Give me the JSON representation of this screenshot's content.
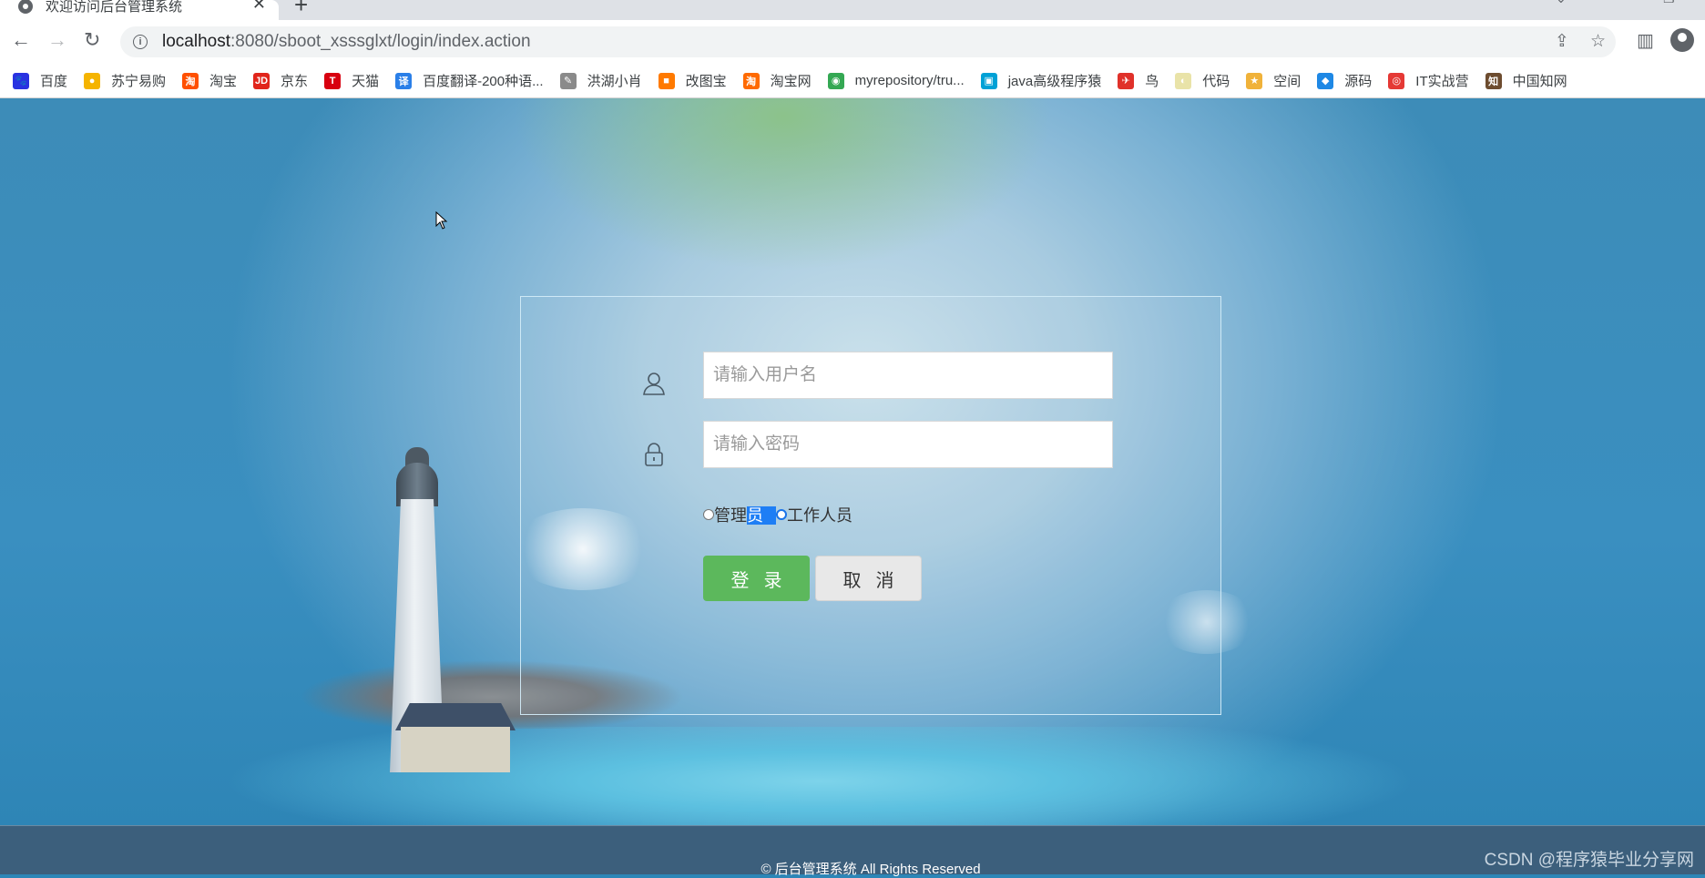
{
  "browser": {
    "tab_title": "欢迎访问后台管理系统",
    "url_host": "localhost",
    "url_rest": ":8080/sboot_xsssglxt/login/index.action",
    "bookmarks": [
      {
        "label": "百度",
        "icon": "baidu-paw-icon",
        "color": "#2932e1",
        "glyph": "🐾"
      },
      {
        "label": "苏宁易购",
        "icon": "suning-icon",
        "color": "#f5b400",
        "glyph": "●"
      },
      {
        "label": "淘宝",
        "icon": "taobao-icon",
        "color": "#ff5000",
        "glyph": "淘"
      },
      {
        "label": "京东",
        "icon": "jd-icon",
        "color": "#e1251b",
        "glyph": "JD"
      },
      {
        "label": "天猫",
        "icon": "tmall-icon",
        "color": "#d8000f",
        "glyph": "T"
      },
      {
        "label": "百度翻译-200种语...",
        "icon": "translate-icon",
        "color": "#2a7fe8",
        "glyph": "译"
      },
      {
        "label": "洪湖小肖",
        "icon": "fox-icon",
        "color": "#8a8a8a",
        "glyph": "✎"
      },
      {
        "label": "改图宝",
        "icon": "gaitubao-icon",
        "color": "#ff7a00",
        "glyph": "■"
      },
      {
        "label": "淘宝网",
        "icon": "taobao-net-icon",
        "color": "#ff6a00",
        "glyph": "淘"
      },
      {
        "label": "myrepository/tru...",
        "icon": "chrome-icon",
        "color": "#34a853",
        "glyph": "◉"
      },
      {
        "label": "java高级程序猿",
        "icon": "bilibili-icon",
        "color": "#00a1d6",
        "glyph": "▣"
      },
      {
        "label": "鸟",
        "icon": "bird-icon",
        "color": "#e0312a",
        "glyph": "✈"
      },
      {
        "label": "代码",
        "icon": "code-icon",
        "color": "#e9e3a8",
        "glyph": "◐"
      },
      {
        "label": "空间",
        "icon": "qzone-icon",
        "color": "#f0b23a",
        "glyph": "★"
      },
      {
        "label": "源码",
        "icon": "source-icon",
        "color": "#1e88e5",
        "glyph": "◆"
      },
      {
        "label": "IT实战营",
        "icon": "it-camp-icon",
        "color": "#e53935",
        "glyph": "◎"
      },
      {
        "label": "中国知网",
        "icon": "cnki-icon",
        "color": "#6d4c2f",
        "glyph": "知"
      }
    ]
  },
  "login": {
    "username_placeholder": "请输入用户名",
    "password_placeholder": "请输入密码",
    "role_admin_a": "管理",
    "role_admin_b": "员",
    "role_staff": "工作人员",
    "selected_role": "工作人员",
    "login_button": "登录",
    "cancel_button": "取消"
  },
  "footer": {
    "copyright": "© 后台管理系统 All Rights Reserved",
    "watermark": "CSDN @程序猿毕业分享网"
  },
  "colors": {
    "login_button": "#5cb85c",
    "cancel_button": "#e8e8e8",
    "footer": "#3c5f7c",
    "selection": "#1e7ef5"
  }
}
